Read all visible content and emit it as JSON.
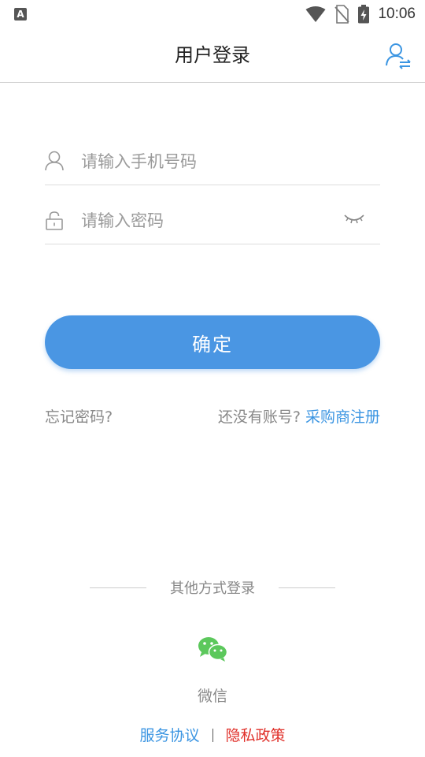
{
  "status_bar": {
    "left_icon": "A",
    "time": "10:06",
    "icons": [
      "wifi-icon",
      "no-sim-icon",
      "battery-charging-icon"
    ]
  },
  "header": {
    "title": "用户登录",
    "right_icon": "user-switch-icon"
  },
  "form": {
    "phone": {
      "placeholder": "请输入手机号码",
      "value": "",
      "icon": "user-icon"
    },
    "password": {
      "placeholder": "请输入密码",
      "value": "",
      "icon": "lock-icon",
      "toggle_icon": "eye-closed-icon"
    },
    "submit_label": "确定"
  },
  "links": {
    "forgot": "忘记密码?",
    "no_account": "还没有账号?",
    "register": "采购商注册"
  },
  "other_login": {
    "title": "其他方式登录",
    "wechat_label": "微信",
    "wechat_icon": "wechat-icon"
  },
  "footer": {
    "service": "服务协议",
    "privacy": "隐私政策"
  },
  "colors": {
    "accent": "#4a96e3",
    "link": "#3b95e2",
    "privacy": "#e0302a",
    "wechat": "#5cc85c"
  }
}
